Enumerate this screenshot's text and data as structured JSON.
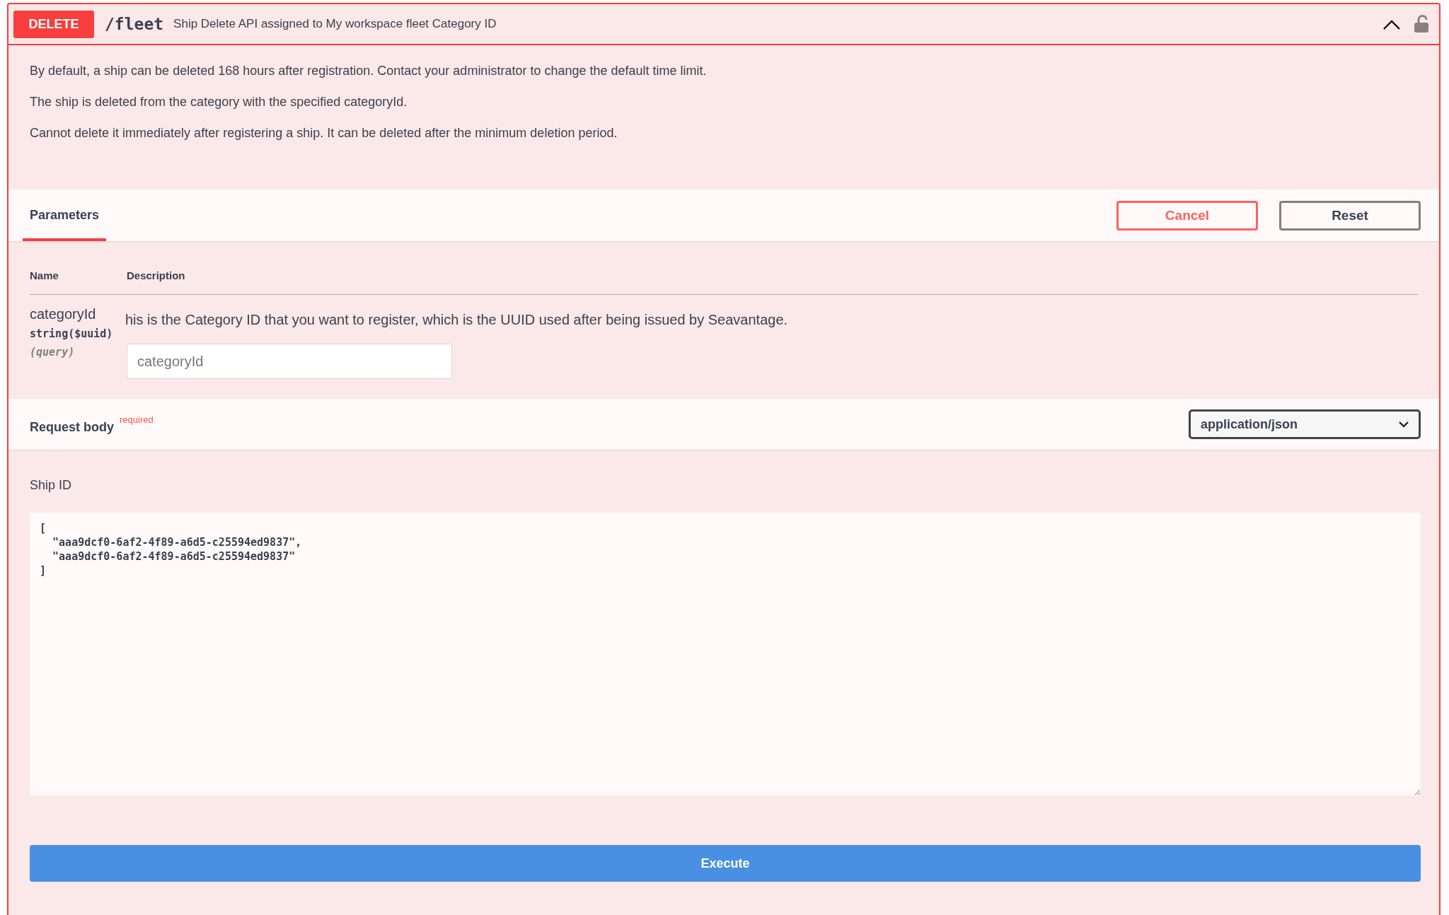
{
  "operation": {
    "method": "DELETE",
    "path": "/fleet",
    "summary": "Ship Delete API assigned to My workspace fleet Category ID",
    "expanded": true,
    "locked": false
  },
  "description": [
    "By default, a ship can be deleted 168 hours after registration. Contact your administrator to change the default time limit.",
    "The ship is deleted from the category with the specified categoryId.",
    "Cannot delete it immediately after registering a ship. It can be deleted after the minimum deletion period."
  ],
  "tabs": [
    {
      "label": "Parameters",
      "selected": true
    }
  ],
  "buttons": {
    "cancel": "Cancel",
    "reset": "Reset"
  },
  "parameters": {
    "columns": [
      "Name",
      "Description"
    ],
    "rows": [
      {
        "name": "categoryId",
        "type": "string($uuid)",
        "location": "(query)",
        "description": "his is the Category ID that you want to register, which is the UUID used after being issued by Seavantage.",
        "placeholder": "categoryId"
      }
    ]
  },
  "request_body": {
    "label": "Request body",
    "required": "required",
    "content_type": "application/json",
    "body_label": "Ship ID",
    "value": "[\n  \"aaa9dcf0-6af2-4f89-a6d5-c25594ed9837\",\n  \"aaa9dcf0-6af2-4f89-a6d5-c25594ed9837\"\n]"
  },
  "execute": "Execute"
}
